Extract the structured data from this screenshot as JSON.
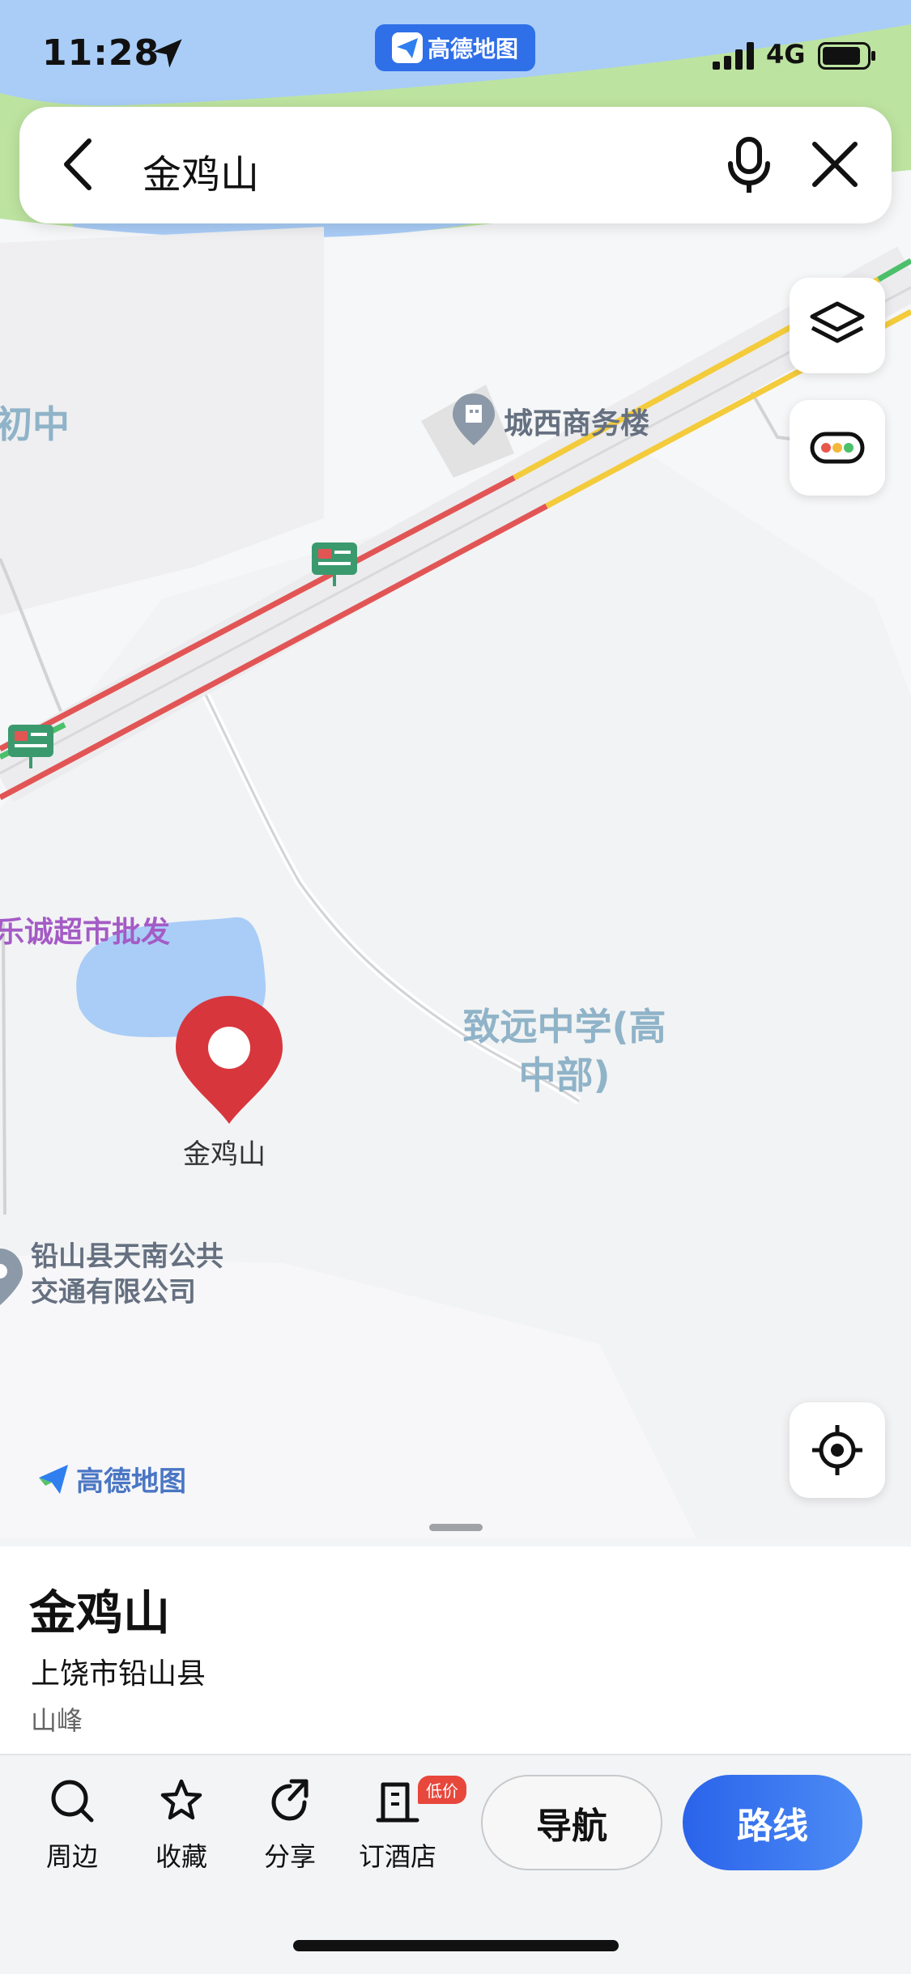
{
  "status_bar": {
    "time": "11:28",
    "network": "4G",
    "app_pill_label": "高德地图"
  },
  "search": {
    "query": "金鸡山"
  },
  "map": {
    "labels": {
      "school_partial": "初中",
      "office_building": "城西商务楼",
      "supermarket_partial": "乐诚超市批发",
      "high_school_line1": "致远中学(高",
      "high_school_line2": "中部)",
      "pin_label": "金鸡山",
      "bus_company_line1": "铅山县天南公共",
      "bus_company_line2": "交通有限公司"
    },
    "watermark": "高德地图",
    "colors": {
      "congestion": "#e25555",
      "slow": "#f3cb3b",
      "clear": "#4cbf6a",
      "water": "#a9cdf7",
      "green_area": "#bde3a0",
      "pin": "#d8363d"
    }
  },
  "controls": {
    "layers_icon": "layers-icon",
    "traffic_icon": "traffic-light-icon",
    "locate_icon": "locate-icon"
  },
  "place": {
    "title": "金鸡山",
    "address": "上饶市铅山县",
    "category": "山峰"
  },
  "actions": {
    "nearby": "周边",
    "favorite": "收藏",
    "share": "分享",
    "hotel": "订酒店",
    "hotel_badge": "低价",
    "navigate": "导航",
    "route": "路线"
  }
}
